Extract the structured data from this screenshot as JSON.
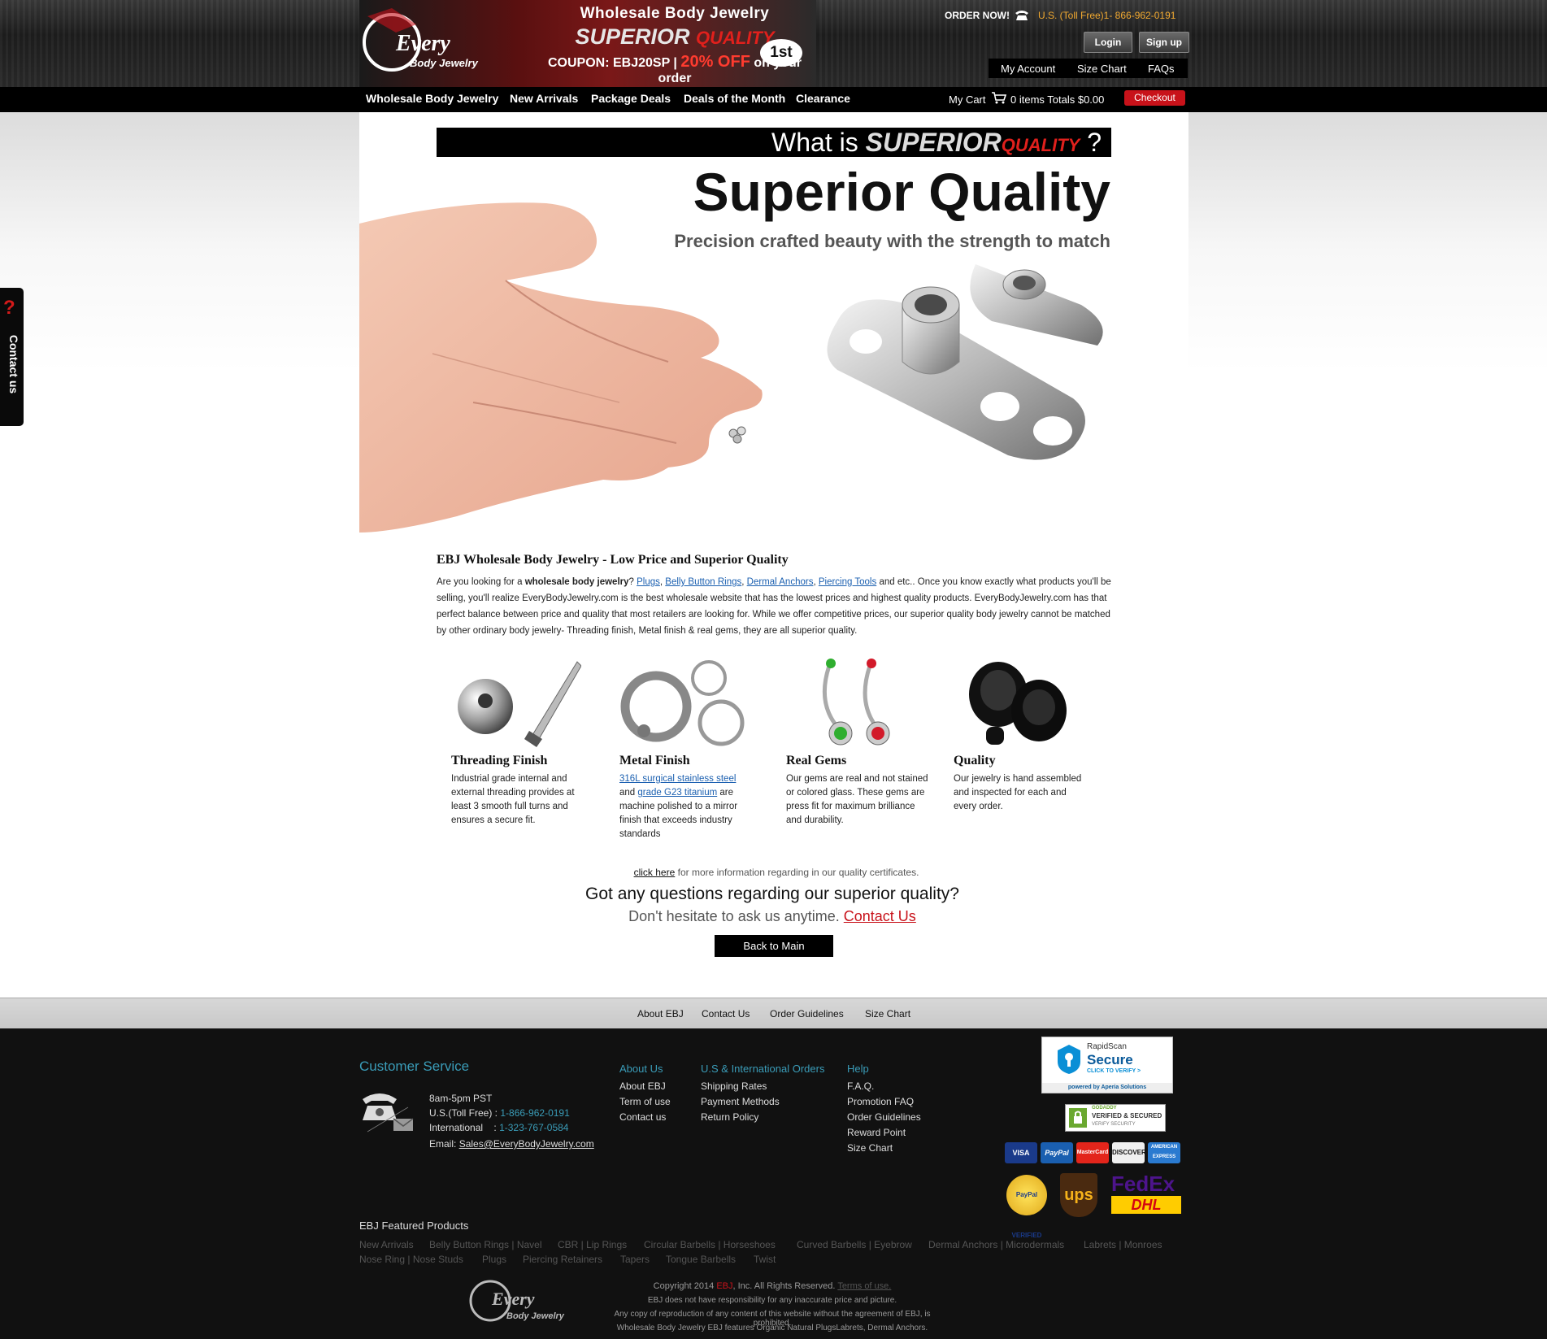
{
  "header": {
    "banner_line1": "Wholesale Body Jewelry",
    "banner_line2": "SUPERIOR",
    "banner_line2_accent": "QUALITY",
    "coupon_label": "COUPON: EBJ20SP |",
    "coupon_pct": "20% OFF",
    "coupon_tail": "on your",
    "coupon_order": "order",
    "first_badge": "1st",
    "order_now": "ORDER NOW!",
    "phone": "U.S. (Toll Free)1- 866-962-0191",
    "login_label": "Login",
    "signup_label": "Sign up",
    "account_links": [
      "My Account",
      "Size Chart",
      "FAQs"
    ],
    "logo_word": "Every",
    "logo_sub": "Body Jewelry"
  },
  "nav": {
    "items": [
      "Wholesale Body Jewelry",
      "New Arrivals",
      "Package Deals",
      "Deals of the Month",
      "Clearance"
    ],
    "my_cart": "My Cart",
    "cart_info": "0 items Totals $0.00",
    "checkout_label": "Checkout"
  },
  "hero": {
    "what_is": "What is",
    "what_is_word": "SUPERIOR",
    "what_is_accent": "QUALITY",
    "what_is_q": "?",
    "title": "Superior Quality",
    "subtitle": "Precision crafted beauty with the strength to match"
  },
  "about": {
    "title": "EBJ Wholesale Body Jewelry - Low Price and Superior Quality",
    "intro": "Are you looking for a",
    "intro_bold": "wholesale body jewelry",
    "links": [
      "Plugs",
      "Belly Button Rings",
      "Dermal Anchors",
      "Piercing Tools"
    ],
    "after_links": "and etc.. Once you know exactly what products you'll be selling, you'll realize EveryBodyJewelry.com is the best wholesale website that has the lowest prices and highest quality products. EveryBodyJewelry.com has that perfect balance between price and quality that most retailers are looking for. While we offer competitive prices, our superior quality body jewelry cannot be matched by other ordinary body jewelry- Threading finish, Metal finish & real gems, they are all superior quality."
  },
  "features": [
    {
      "title": "Threading Finish",
      "text": "Industrial grade internal and external threading provides at least 3 smooth full turns and ensures a secure fit."
    },
    {
      "title": "Metal Finish",
      "link1": "316L surgical stainless steel",
      "mid": "and",
      "link2": "grade G23 titanium",
      "text": "are machine polished to a mirror finish that exceeds industry standards"
    },
    {
      "title": "Real Gems",
      "text": "Our gems are real and not stained or colored glass. These gems are press fit for maximum brilliance and durability."
    },
    {
      "title": "Quality",
      "text": "Our jewelry is hand assembled and inspected for each and every order."
    }
  ],
  "cta": {
    "click_here": "click here",
    "cert_text": "for more information regarding in our quality certificates.",
    "question": "Got any questions regarding our superior quality?",
    "ask": "Don't hesitate to ask us anytime.",
    "contact_link": "Contact Us",
    "back_label": "Back to Main"
  },
  "footer_links": [
    "About EBJ",
    "Contact Us",
    "Order Guidelines",
    "Size Chart"
  ],
  "customer_service": {
    "title": "Customer Service",
    "hours": "8am-5pm PST",
    "us_label": "U.S.(Toll Free) :",
    "us_phone": "1-866-962-0191",
    "intl_label": "International    :",
    "intl_phone": "1-323-767-0584",
    "email_label": "Email:",
    "email": "Sales@EveryBodyJewelry.com"
  },
  "footer_cols": [
    {
      "title": "About Us",
      "items": [
        "About EBJ",
        "Term of use",
        "Contact us"
      ]
    },
    {
      "title": "U.S & International Orders",
      "items": [
        "Shipping Rates",
        "Payment Methods",
        "Return Policy"
      ]
    },
    {
      "title": "Help",
      "items": [
        "F.A.Q.",
        "Promotion FAQ",
        "Order Guidelines",
        "Reward Point",
        "Size Chart"
      ]
    }
  ],
  "badges": {
    "rapidscan_title": "RapidScan",
    "rapidscan_secure": "Secure",
    "rapidscan_verify": "CLICK TO VERIFY >",
    "rapidscan_by": "powered by Aperia Solutions",
    "godaddy": "GODADDY",
    "godaddy_verified": "VERIFIED & SECURED",
    "godaddy_verify": "VERIFY SECURITY",
    "cards": [
      "VISA",
      "PayPal",
      "MasterCard",
      "DISCOVER",
      "AMERICAN EXPRESS"
    ],
    "paypal_verified": "PayPal VERIFIED",
    "ups": "ups",
    "fedex": "FedEx",
    "dhl": "DHL"
  },
  "featured_products": {
    "title": "EBJ Featured Products",
    "row1": [
      "New Arrivals",
      "Belly Button Rings | Navel",
      "CBR | Lip Rings",
      "Circular Barbells | Horseshoes",
      "Curved Barbells | Eyebrow",
      "Dermal Anchors | Microdermals",
      "Labrets | Monroes"
    ],
    "row2": [
      "Nose Ring | Nose Studs",
      "Plugs",
      "Piercing Retainers",
      "Tapers",
      "Tongue Barbells",
      "Twist"
    ]
  },
  "copyright": {
    "line1_pre": "Copyright 2014",
    "line1_ebj": "EBJ",
    "line1_post": ", Inc. All Rights Reserved.",
    "terms": "Terms of use.",
    "line2": "EBJ does not have responsibility for any inaccurate price and picture.",
    "line3": "Any copy of reproduction of any content of this website without the agreement of EBJ, is prohibited.",
    "line4": "Wholesale Body Jewelry EBJ features Organic Natural PlugsLabrets, Dermal Anchors."
  },
  "contact_tab": {
    "q": "?",
    "label": "Contact us"
  },
  "colors": {
    "accent_red": "#c8121a",
    "footer_blue": "#3a9cb8",
    "link_blue": "#1a5fb0"
  }
}
